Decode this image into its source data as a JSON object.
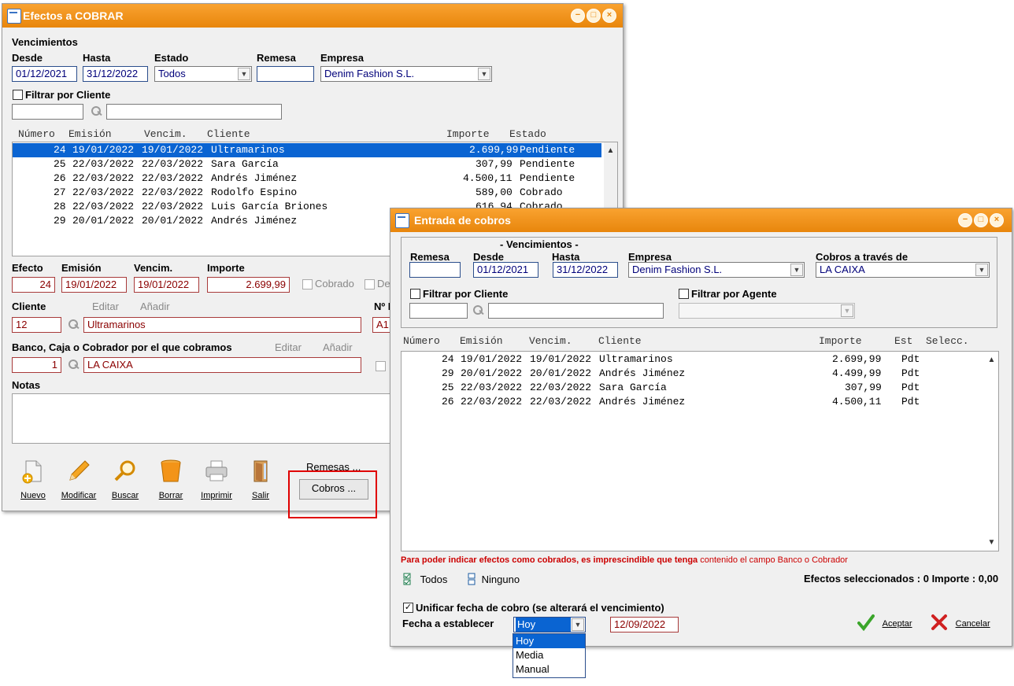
{
  "win1": {
    "title": "Efectos a COBRAR",
    "section_title": "Vencimientos",
    "labels": {
      "desde": "Desde",
      "hasta": "Hasta",
      "estado": "Estado",
      "remesa": "Remesa",
      "empresa": "Empresa",
      "filtrar_cliente": "Filtrar por Cliente"
    },
    "desde": "01/12/2021",
    "hasta": "31/12/2022",
    "estado": "Todos",
    "remesa": "",
    "empresa": "Denim Fashion S.L.",
    "columns": {
      "numero": "Número",
      "emision": "Emisión",
      "vencim": "Vencim.",
      "cliente": "Cliente",
      "importe": "Importe",
      "estado": "Estado"
    },
    "rows": [
      {
        "numero": "24",
        "emision": "19/01/2022",
        "vencim": "19/01/2022",
        "cliente": "Ultramarinos",
        "importe": "2.699,99",
        "estado": "Pendiente"
      },
      {
        "numero": "25",
        "emision": "22/03/2022",
        "vencim": "22/03/2022",
        "cliente": "Sara García",
        "importe": "307,99",
        "estado": "Pendiente"
      },
      {
        "numero": "26",
        "emision": "22/03/2022",
        "vencim": "22/03/2022",
        "cliente": "Andrés Jiménez",
        "importe": "4.500,11",
        "estado": "Pendiente"
      },
      {
        "numero": "27",
        "emision": "22/03/2022",
        "vencim": "22/03/2022",
        "cliente": "Rodolfo Espino",
        "importe": "589,00",
        "estado": "Cobrado"
      },
      {
        "numero": "28",
        "emision": "22/03/2022",
        "vencim": "22/03/2022",
        "cliente": "Luis García Briones",
        "importe": "616,94",
        "estado": "Cobrado"
      },
      {
        "numero": "29",
        "emision": "20/01/2022",
        "vencim": "20/01/2022",
        "cliente": "Andrés Jiménez",
        "importe": "",
        "estado": ""
      }
    ],
    "detail": {
      "labels": {
        "efecto": "Efecto",
        "emision": "Emisión",
        "vencim": "Vencim.",
        "importe": "Importe",
        "cobrado": "Cobrado",
        "de": "De",
        "cliente": "Cliente",
        "editar": "Editar",
        "anadir": "Añadir",
        "n": "Nº I",
        "banco": "Banco, Caja o Cobrador por el que cobramos",
        "notas": "Notas"
      },
      "efecto": "24",
      "emision": "19/01/2022",
      "vencim": "19/01/2022",
      "importe": "2.699,99",
      "cliente_code": "12",
      "cliente_name": "Ultramarinos",
      "n_value": "A1",
      "banco_code": "1",
      "banco_name": "LA CAIXA"
    },
    "toolbar": {
      "nuevo": "Nuevo",
      "modificar": "Modificar",
      "buscar": "Buscar",
      "borrar": "Borrar",
      "imprimir": "Imprimir",
      "salir": "Salir"
    },
    "remesas_link": "Remesas ...",
    "cobros_button": "Cobros ..."
  },
  "win2": {
    "title": "Entrada de cobros",
    "section_title": "- Vencimientos -",
    "labels": {
      "remesa": "Remesa",
      "desde": "Desde",
      "hasta": "Hasta",
      "empresa": "Empresa",
      "cobros_via": "Cobros a través de",
      "filtrar_cliente": "Filtrar por Cliente",
      "filtrar_agente": "Filtrar por Agente"
    },
    "remesa": "",
    "desde": "01/12/2021",
    "hasta": "31/12/2022",
    "empresa": "Denim Fashion S.L.",
    "cobros_via": "LA CAIXA",
    "columns": {
      "numero": "Número",
      "emision": "Emisión",
      "vencim": "Vencim.",
      "cliente": "Cliente",
      "importe": "Importe",
      "est": "Est",
      "selecc": "Selecc."
    },
    "rows": [
      {
        "numero": "24",
        "emision": "19/01/2022",
        "vencim": "19/01/2022",
        "cliente": "Ultramarinos",
        "importe": "2.699,99",
        "est": "Pdt"
      },
      {
        "numero": "29",
        "emision": "20/01/2022",
        "vencim": "20/01/2022",
        "cliente": "Andrés Jiménez",
        "importe": "4.499,99",
        "est": "Pdt"
      },
      {
        "numero": "25",
        "emision": "22/03/2022",
        "vencim": "22/03/2022",
        "cliente": "Sara García",
        "importe": "307,99",
        "est": "Pdt"
      },
      {
        "numero": "26",
        "emision": "22/03/2022",
        "vencim": "22/03/2022",
        "cliente": "Andrés Jiménez",
        "importe": "4.500,11",
        "est": "Pdt"
      }
    ],
    "warning_bold": "Para poder indicar efectos como cobrados, es imprescindible que tenga",
    "warning_rest": "contenido el campo Banco o Cobrador",
    "todos": "Todos",
    "ninguno": "Ninguno",
    "summary": "Efectos seleccionados : 0 Importe : 0,00",
    "unificar": "Unificar fecha de cobro (se alterará el vencimiento)",
    "fecha_label": "Fecha a establecer",
    "fecha_option": "Hoy",
    "fecha_value": "12/09/2022",
    "options": [
      "Hoy",
      "Media",
      "Manual"
    ],
    "aceptar": "Aceptar",
    "cancelar": "Cancelar"
  },
  "colors": {
    "titlebar": "#f39418",
    "selection": "#0a64d2",
    "warning": "#cc0000",
    "highlight_box": "#e00000"
  }
}
